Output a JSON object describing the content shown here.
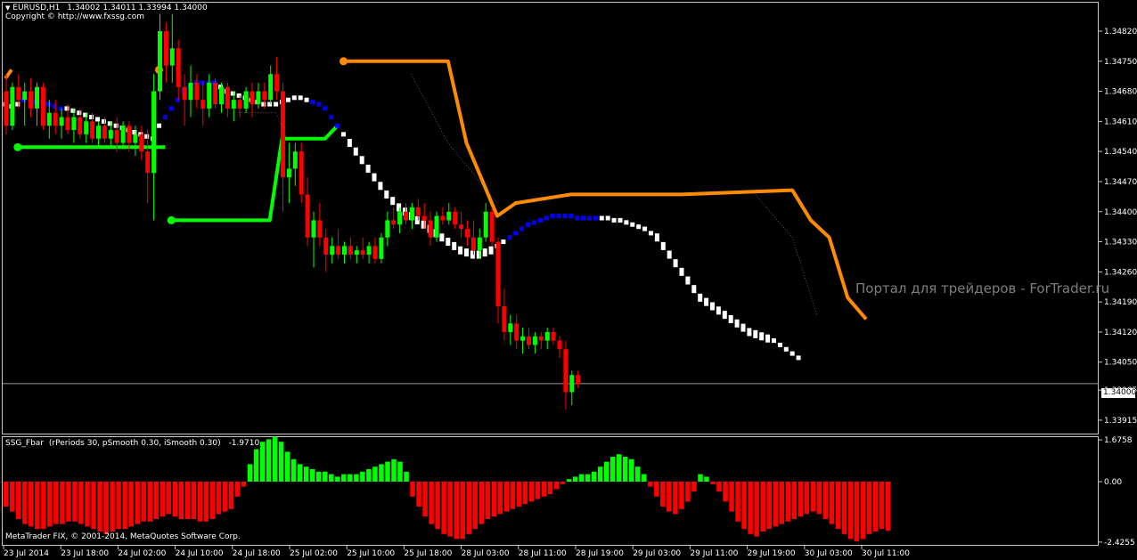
{
  "header": {
    "symbol": "EURUSD,H1",
    "ohlc": "1.34002 1.34011 1.33994 1.34000",
    "copyright": "Copyright © http://www.fxssg.com"
  },
  "watermark": "Портал для трейдеров - ForTrader.ru",
  "footer_copyright": "MetaTrader FIX, © 2001-2014, MetaQuotes Software Corp.",
  "colors": {
    "background": "#000000",
    "bull": "#00ff00",
    "bear": "#ff0000",
    "trail_up": "#00ff00",
    "trail_down": "#ff8c00",
    "ma_white": "#ffffff",
    "ma_blue": "#0000ff",
    "grid": "#c8c8c8"
  },
  "chart_data": [
    {
      "type": "candlestick",
      "title": "EURUSD,H1",
      "current_price": "1.34000",
      "y_ticks": [
        "1.34820",
        "1.34750",
        "1.34680",
        "1.34610",
        "1.34540",
        "1.34470",
        "1.34400",
        "1.34330",
        "1.34260",
        "1.34190",
        "1.34120",
        "1.34050",
        "1.33985",
        "1.33915"
      ],
      "ylim": [
        1.3389,
        1.3488
      ],
      "x_ticks": [
        "23 Jul 2014",
        "23 Jul 18:00",
        "24 Jul 02:00",
        "24 Jul 10:00",
        "24 Jul 18:00",
        "25 Jul 02:00",
        "25 Jul 10:00",
        "25 Jul 18:00",
        "28 Jul 03:00",
        "28 Jul 11:00",
        "28 Jul 19:00",
        "29 Jul 03:00",
        "29 Jul 11:00",
        "29 Jul 19:00",
        "30 Jul 03:00",
        "30 Jul 11:00"
      ],
      "trail_up": [
        {
          "x": 2,
          "y": 1.3455
        },
        {
          "x": 26,
          "y": 1.3455
        },
        {
          "x": 27,
          "y": 1.3438
        },
        {
          "x": 43,
          "y": 1.3438
        },
        {
          "x": 45,
          "y": 1.3457
        },
        {
          "x": 52,
          "y": 1.3457
        },
        {
          "x": 54,
          "y": 1.346
        }
      ],
      "trail_down": [
        {
          "x": 0,
          "y": 1.3471
        },
        {
          "x": 1,
          "y": 1.3473
        },
        {
          "x": 55,
          "y": 1.3475
        },
        {
          "x": 72,
          "y": 1.3475
        },
        {
          "x": 75,
          "y": 1.3456
        },
        {
          "x": 80,
          "y": 1.3439
        },
        {
          "x": 83,
          "y": 1.3442
        },
        {
          "x": 92,
          "y": 1.3444
        },
        {
          "x": 110,
          "y": 1.3444
        },
        {
          "x": 128,
          "y": 1.3445
        },
        {
          "x": 131,
          "y": 1.3438
        },
        {
          "x": 134,
          "y": 1.3434
        },
        {
          "x": 137,
          "y": 1.342
        },
        {
          "x": 140,
          "y": 1.3415
        }
      ],
      "ma_points": [
        1.3465,
        1.34645,
        1.3465,
        1.3466,
        1.3466,
        1.34655,
        1.34655,
        1.3465,
        1.34645,
        1.3464,
        1.3464,
        1.34635,
        1.3463,
        1.34625,
        1.3462,
        1.34615,
        1.3461,
        1.34605,
        1.346,
        1.34595,
        1.3459,
        1.34585,
        1.3458,
        1.34575,
        1.3457,
        1.346,
        1.3462,
        1.3464,
        1.3466,
        1.3468,
        1.3469,
        1.347,
        1.347,
        1.347,
        1.347,
        1.3469,
        1.3468,
        1.34675,
        1.3467,
        1.34665,
        1.3466,
        1.34655,
        1.3465,
        1.3465,
        1.3465,
        1.34655,
        1.3466,
        1.34665,
        1.34665,
        1.3466,
        1.34655,
        1.3465,
        1.3464,
        1.3462,
        1.346,
        1.3458,
        1.3456,
        1.3454,
        1.3452,
        1.345,
        1.3448,
        1.3446,
        1.3444,
        1.34425,
        1.3441,
        1.344,
        1.3439,
        1.3438,
        1.3437,
        1.3436,
        1.3435,
        1.3434,
        1.3433,
        1.3432,
        1.3431,
        1.34305,
        1.343,
        1.343,
        1.34305,
        1.3431,
        1.3432,
        1.3433,
        1.3434,
        1.3435,
        1.3436,
        1.3437,
        1.34375,
        1.3438,
        1.34385,
        1.3439,
        1.3439,
        1.3439,
        1.3439,
        1.34385,
        1.34385,
        1.34385,
        1.34385,
        1.34385,
        1.34385,
        1.3438,
        1.3438,
        1.34375,
        1.3437,
        1.34365,
        1.3436,
        1.3435,
        1.3434,
        1.3432,
        1.343,
        1.3428,
        1.3426,
        1.3424,
        1.3422,
        1.342,
        1.3419,
        1.3418,
        1.3417,
        1.3416,
        1.3415,
        1.3414,
        1.3413,
        1.3412,
        1.34115,
        1.3411,
        1.34105,
        1.341,
        1.3409,
        1.3408,
        1.3407,
        1.3406
      ],
      "ma_blue_ranges": [
        [
          3,
          9
        ],
        [
          26,
          34
        ],
        [
          50,
          54
        ],
        [
          82,
          96
        ]
      ],
      "candles": [
        [
          1.3468,
          1.3472,
          1.3458,
          1.346
        ],
        [
          1.346,
          1.347,
          1.3459,
          1.3469
        ],
        [
          1.3469,
          1.3472,
          1.3464,
          1.3466
        ],
        [
          1.3466,
          1.347,
          1.346,
          1.3468
        ],
        [
          1.3468,
          1.3471,
          1.3462,
          1.3464
        ],
        [
          1.3464,
          1.347,
          1.346,
          1.3469
        ],
        [
          1.3469,
          1.347,
          1.3459,
          1.346
        ],
        [
          1.346,
          1.3466,
          1.3457,
          1.3463
        ],
        [
          1.3463,
          1.3466,
          1.3458,
          1.346
        ],
        [
          1.346,
          1.3464,
          1.3457,
          1.3462
        ],
        [
          1.3462,
          1.3465,
          1.3458,
          1.3459
        ],
        [
          1.3459,
          1.3464,
          1.3456,
          1.3462
        ],
        [
          1.3462,
          1.3464,
          1.3457,
          1.3458
        ],
        [
          1.3458,
          1.3463,
          1.3456,
          1.3461
        ],
        [
          1.3461,
          1.3463,
          1.3456,
          1.3457
        ],
        [
          1.3457,
          1.3461,
          1.3455,
          1.346
        ],
        [
          1.346,
          1.3462,
          1.3456,
          1.3457
        ],
        [
          1.3457,
          1.3461,
          1.3455,
          1.3459
        ],
        [
          1.3459,
          1.3462,
          1.3454,
          1.3456
        ],
        [
          1.3456,
          1.3461,
          1.3455,
          1.346
        ],
        [
          1.346,
          1.3461,
          1.3454,
          1.3456
        ],
        [
          1.3456,
          1.346,
          1.3453,
          1.3458
        ],
        [
          1.3458,
          1.346,
          1.3452,
          1.3454
        ],
        [
          1.3454,
          1.3459,
          1.3442,
          1.3449
        ],
        [
          1.3449,
          1.3472,
          1.3438,
          1.3468
        ],
        [
          1.3468,
          1.3486,
          1.3466,
          1.3482
        ],
        [
          1.3482,
          1.3484,
          1.347,
          1.3474
        ],
        [
          1.3474,
          1.3486,
          1.347,
          1.3478
        ],
        [
          1.3478,
          1.348,
          1.3466,
          1.3469
        ],
        [
          1.3469,
          1.3472,
          1.346,
          1.3466
        ],
        [
          1.3466,
          1.3474,
          1.3462,
          1.347
        ],
        [
          1.347,
          1.3472,
          1.3464,
          1.3466
        ],
        [
          1.3466,
          1.347,
          1.346,
          1.3464
        ],
        [
          1.3464,
          1.3472,
          1.3462,
          1.347
        ],
        [
          1.347,
          1.3471,
          1.3464,
          1.3465
        ],
        [
          1.3465,
          1.347,
          1.3463,
          1.3469
        ],
        [
          1.3469,
          1.347,
          1.3462,
          1.3464
        ],
        [
          1.3464,
          1.3468,
          1.3461,
          1.3466
        ],
        [
          1.3466,
          1.3467,
          1.3462,
          1.3464
        ],
        [
          1.3464,
          1.3469,
          1.3463,
          1.3468
        ],
        [
          1.3468,
          1.347,
          1.3462,
          1.3465
        ],
        [
          1.3465,
          1.347,
          1.3464,
          1.3468
        ],
        [
          1.3468,
          1.347,
          1.3464,
          1.3466
        ],
        [
          1.3466,
          1.3474,
          1.3465,
          1.3472
        ],
        [
          1.3472,
          1.3476,
          1.3466,
          1.3468
        ],
        [
          1.3468,
          1.347,
          1.344,
          1.3448
        ],
        [
          1.3448,
          1.3456,
          1.3442,
          1.345
        ],
        [
          1.345,
          1.3456,
          1.3446,
          1.3454
        ],
        [
          1.3454,
          1.3456,
          1.3442,
          1.3444
        ],
        [
          1.3444,
          1.3448,
          1.3432,
          1.3434
        ],
        [
          1.3434,
          1.344,
          1.3427,
          1.3438
        ],
        [
          1.3438,
          1.3442,
          1.3432,
          1.3434
        ],
        [
          1.3434,
          1.3436,
          1.3426,
          1.343
        ],
        [
          1.343,
          1.3434,
          1.3428,
          1.3432
        ],
        [
          1.3432,
          1.3436,
          1.3429,
          1.343
        ],
        [
          1.343,
          1.3433,
          1.3428,
          1.3432
        ],
        [
          1.3432,
          1.3434,
          1.3429,
          1.343
        ],
        [
          1.343,
          1.3432,
          1.3428,
          1.3431
        ],
        [
          1.3431,
          1.3434,
          1.3429,
          1.343
        ],
        [
          1.343,
          1.3433,
          1.3428,
          1.3432
        ],
        [
          1.3432,
          1.3434,
          1.3428,
          1.3429
        ],
        [
          1.3429,
          1.3435,
          1.3428,
          1.3434
        ],
        [
          1.3434,
          1.344,
          1.3432,
          1.3438
        ],
        [
          1.3438,
          1.3441,
          1.3436,
          1.3437
        ],
        [
          1.3437,
          1.3441,
          1.3435,
          1.344
        ],
        [
          1.344,
          1.3442,
          1.3437,
          1.3438
        ],
        [
          1.3438,
          1.3442,
          1.3436,
          1.3441
        ],
        [
          1.3441,
          1.3443,
          1.3438,
          1.3439
        ],
        [
          1.3439,
          1.3442,
          1.3436,
          1.3438
        ],
        [
          1.3438,
          1.344,
          1.3432,
          1.3434
        ],
        [
          1.3434,
          1.344,
          1.3433,
          1.3439
        ],
        [
          1.3439,
          1.3441,
          1.3437,
          1.3438
        ],
        [
          1.3438,
          1.3442,
          1.3437,
          1.344
        ],
        [
          1.344,
          1.3441,
          1.3436,
          1.3437
        ],
        [
          1.3437,
          1.344,
          1.3434,
          1.3436
        ],
        [
          1.3436,
          1.3438,
          1.3432,
          1.3434
        ],
        [
          1.3434,
          1.3438,
          1.343,
          1.3431
        ],
        [
          1.3431,
          1.3436,
          1.3429,
          1.3434
        ],
        [
          1.3434,
          1.3442,
          1.3433,
          1.344
        ],
        [
          1.344,
          1.3441,
          1.3432,
          1.3433
        ],
        [
          1.3433,
          1.3434,
          1.3414,
          1.3418
        ],
        [
          1.3418,
          1.3422,
          1.341,
          1.3412
        ],
        [
          1.3412,
          1.3416,
          1.3409,
          1.3414
        ],
        [
          1.3414,
          1.3416,
          1.3408,
          1.341
        ],
        [
          1.341,
          1.3413,
          1.3407,
          1.3411
        ],
        [
          1.3411,
          1.3413,
          1.3408,
          1.3409
        ],
        [
          1.3409,
          1.3412,
          1.3407,
          1.3411
        ],
        [
          1.3411,
          1.3412,
          1.3408,
          1.341
        ],
        [
          1.341,
          1.3413,
          1.3408,
          1.3412
        ],
        [
          1.3412,
          1.3413,
          1.3409,
          1.341
        ],
        [
          1.341,
          1.3411,
          1.3406,
          1.3408
        ],
        [
          1.3408,
          1.341,
          1.3394,
          1.3398
        ],
        [
          1.3398,
          1.3403,
          1.3395,
          1.3402
        ],
        [
          1.3402,
          1.3403,
          1.3399,
          1.34
        ]
      ]
    },
    {
      "type": "bar",
      "title": "SSG_Fbar",
      "params": "(rPeriods 30, pSmooth 0.30, iSmooth 0.30)",
      "current_value": "-1.9710",
      "y_ticks": [
        "1.6758",
        "0.00",
        "-2.4255"
      ],
      "ylim": [
        -2.5,
        1.75
      ],
      "values": [
        -1.0,
        -1.2,
        -1.5,
        -1.7,
        -1.8,
        -1.9,
        -1.9,
        -1.8,
        -1.7,
        -1.7,
        -1.6,
        -1.6,
        -1.7,
        -1.8,
        -1.9,
        -2.0,
        -2.1,
        -2.0,
        -1.9,
        -1.9,
        -1.8,
        -1.7,
        -1.6,
        -1.6,
        -1.5,
        -1.4,
        -1.3,
        -1.4,
        -1.5,
        -1.5,
        -1.5,
        -1.6,
        -1.6,
        -1.5,
        -1.3,
        -1.2,
        -1.1,
        -0.6,
        -0.2,
        0.7,
        1.3,
        1.6,
        1.7,
        1.8,
        1.6,
        1.2,
        0.9,
        0.7,
        0.6,
        0.5,
        0.4,
        0.4,
        0.3,
        0.2,
        0.3,
        0.3,
        0.3,
        0.4,
        0.5,
        0.6,
        0.7,
        0.8,
        0.9,
        0.8,
        0.4,
        -0.6,
        -1.0,
        -1.4,
        -1.7,
        -1.9,
        -2.1,
        -2.2,
        -2.3,
        -2.3,
        -2.1,
        -1.9,
        -1.7,
        -1.5,
        -1.4,
        -1.3,
        -1.2,
        -1.1,
        -1.0,
        -0.9,
        -0.8,
        -0.7,
        -0.6,
        -0.5,
        -0.3,
        -0.1,
        0.1,
        0.2,
        0.3,
        0.3,
        0.4,
        0.6,
        0.8,
        1.0,
        1.1,
        1.0,
        0.9,
        0.6,
        0.3,
        -0.2,
        -0.6,
        -1.0,
        -1.2,
        -1.3,
        -1.1,
        -0.8,
        -0.4,
        0.3,
        0.2,
        -0.1,
        -0.4,
        -0.8,
        -1.2,
        -1.6,
        -1.9,
        -2.1,
        -2.2,
        -2.0,
        -1.9,
        -1.8,
        -1.7,
        -1.6,
        -1.5,
        -1.4,
        -1.3,
        -1.2,
        -1.3,
        -1.5,
        -1.7,
        -1.9,
        -2.1,
        -2.3,
        -2.4,
        -2.3,
        -2.1,
        -2.0,
        -1.9,
        -1.97
      ]
    }
  ]
}
